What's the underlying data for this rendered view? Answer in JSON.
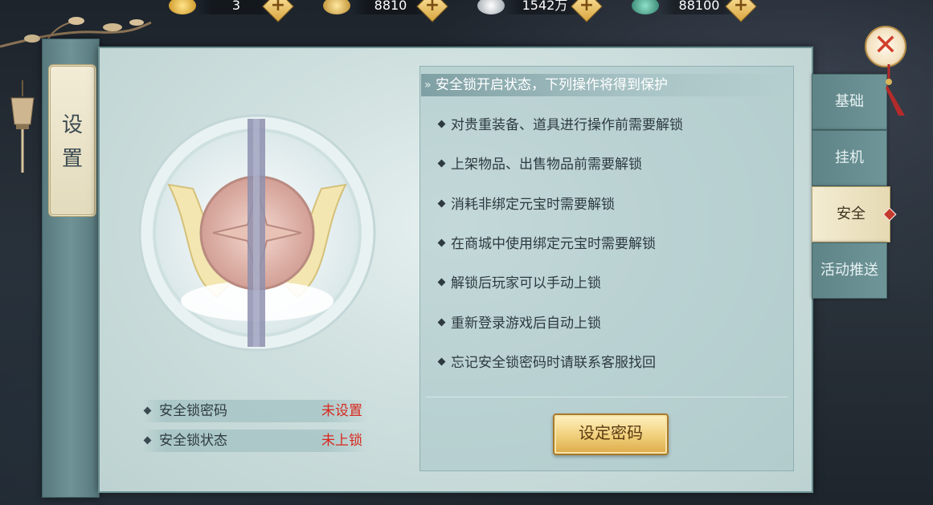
{
  "currencies": [
    {
      "icon": "gold-ingot-icon",
      "value": "3"
    },
    {
      "icon": "bound-gold-ingot-icon",
      "value": "8810"
    },
    {
      "icon": "silver-ingot-icon",
      "value": "1542万"
    },
    {
      "icon": "jade-coin-icon",
      "value": "88100"
    }
  ],
  "title": {
    "line1": "设",
    "line2": "置"
  },
  "status": [
    {
      "label": "安全锁密码",
      "value": "未设置"
    },
    {
      "label": "安全锁状态",
      "value": "未上锁"
    }
  ],
  "rules": {
    "header": "安全锁开启状态，下列操作将得到保护",
    "items": [
      "对贵重装备、道具进行操作前需要解锁",
      "上架物品、出售物品前需要解锁",
      "消耗非绑定元宝时需要解锁",
      "在商城中使用绑定元宝时需要解锁",
      "解锁后玩家可以手动上锁",
      "重新登录游戏后自动上锁",
      "忘记安全锁密码时请联系客服找回"
    ]
  },
  "set_password_label": "设定密码",
  "tabs": [
    {
      "label": "基础",
      "active": false
    },
    {
      "label": "挂机",
      "active": false
    },
    {
      "label": "安全",
      "active": true
    },
    {
      "label": "活动推送",
      "active": false
    }
  ],
  "colors": {
    "accent_red": "#d8281e",
    "gold": "#f0cf7a",
    "panel": "#cfe0df"
  }
}
